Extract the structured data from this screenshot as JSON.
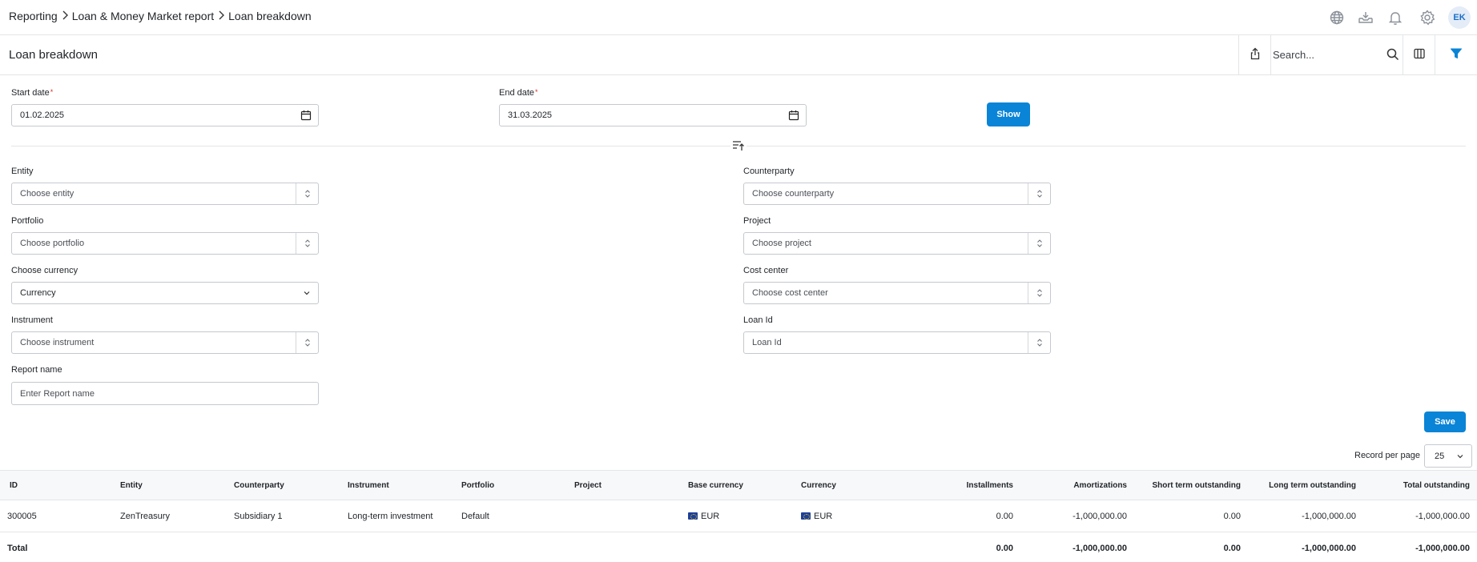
{
  "breadcrumb": {
    "items": [
      "Reporting",
      "Loan & Money Market report",
      "Loan breakdown"
    ]
  },
  "user": {
    "initials": "EK"
  },
  "header": {
    "title": "Loan breakdown",
    "search_placeholder": "Search..."
  },
  "form": {
    "start_date": {
      "label": "Start date",
      "value": "01.02.2025"
    },
    "end_date": {
      "label": "End date",
      "value": "31.03.2025"
    },
    "show_label": "Show",
    "entity": {
      "label": "Entity",
      "placeholder": "Choose entity"
    },
    "counterparty": {
      "label": "Counterparty",
      "placeholder": "Choose counterparty"
    },
    "portfolio": {
      "label": "Portfolio",
      "placeholder": "Choose portfolio"
    },
    "project": {
      "label": "Project",
      "placeholder": "Choose project"
    },
    "currency": {
      "label": "Choose currency",
      "value": "Currency"
    },
    "cost_center": {
      "label": "Cost center",
      "placeholder": "Choose cost center"
    },
    "instrument": {
      "label": "Instrument",
      "placeholder": "Choose instrument"
    },
    "loan_id": {
      "label": "Loan Id",
      "placeholder": "Loan Id"
    },
    "report_name": {
      "label": "Report name",
      "placeholder": "Enter Report name"
    },
    "save_label": "Save"
  },
  "pagination": {
    "label": "Record per page",
    "value": "25"
  },
  "table": {
    "columns": [
      "ID",
      "Entity",
      "Counterparty",
      "Instrument",
      "Portfolio",
      "Project",
      "Base currency",
      "Currency",
      "Installments",
      "Amortizations",
      "Short term outstanding",
      "Long term outstanding",
      "Total outstanding"
    ],
    "rows": [
      {
        "id": "300005",
        "entity": "ZenTreasury",
        "counterparty": "Subsidiary 1",
        "instrument": "Long-term investment",
        "portfolio": "Default",
        "project": "",
        "base_currency": "EUR",
        "currency": "EUR",
        "installments": "0.00",
        "amortizations": "-1,000,000.00",
        "short_term": "0.00",
        "long_term": "-1,000,000.00",
        "total": "-1,000,000.00"
      }
    ],
    "totals": {
      "label": "Total",
      "installments": "0.00",
      "amortizations": "-1,000,000.00",
      "short_term": "0.00",
      "long_term": "-1,000,000.00",
      "total": "-1,000,000.00"
    }
  },
  "colors": {
    "accent": "#0a84d6",
    "required": "#d93025",
    "border": "#e3e5e8"
  },
  "icons": [
    "globe-icon",
    "download-tray-icon",
    "bell-icon",
    "gear-icon",
    "share-icon",
    "search-icon",
    "columns-icon",
    "filter-icon",
    "calendar-icon",
    "collapse-icon",
    "stepper-icon",
    "chevron-down-icon",
    "eu-flag-icon"
  ]
}
